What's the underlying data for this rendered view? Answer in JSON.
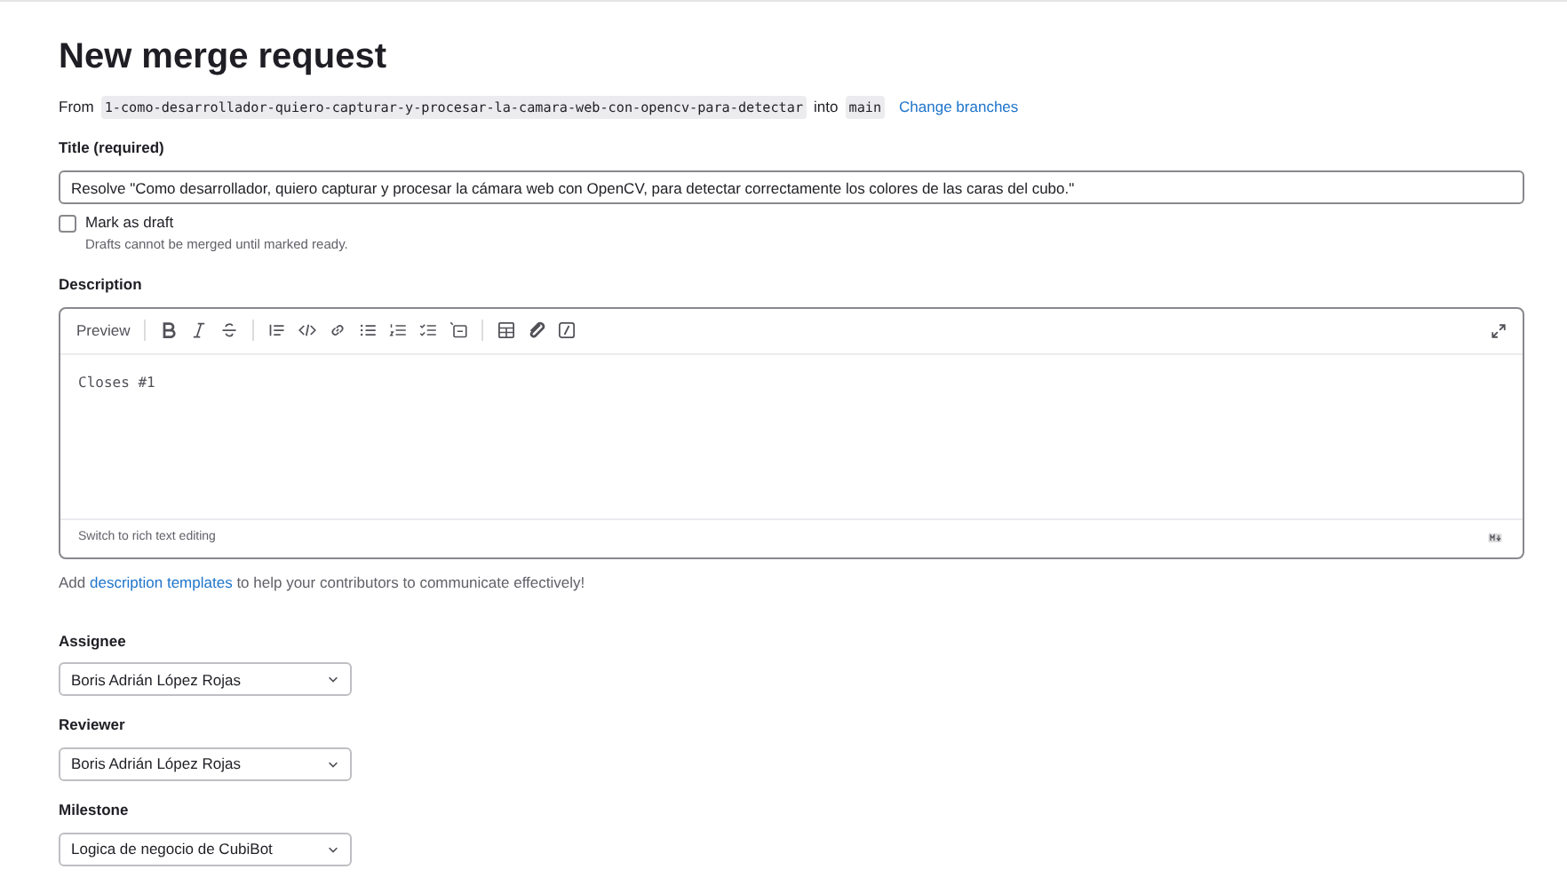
{
  "page_title": "New merge request",
  "branches": {
    "from_label": "From",
    "source": "1-como-desarrollador-quiero-capturar-y-procesar-la-camara-web-con-opencv-para-detectar",
    "into_label": "into",
    "target": "main",
    "change_link": "Change branches"
  },
  "title_field": {
    "label": "Title (required)",
    "value": "Resolve \"Como desarrollador, quiero capturar y procesar la cámara web con OpenCV, para detectar correctamente los colores de las caras del cubo.\""
  },
  "draft": {
    "label": "Mark as draft",
    "checked": false,
    "help": "Drafts cannot be merged until marked ready."
  },
  "description": {
    "label": "Description",
    "preview_tab": "Preview",
    "value": "Closes #1",
    "switch_link": "Switch to rich text editing",
    "help_before": "Add ",
    "help_link": "description templates",
    "help_after": " to help your contributors to communicate effectively!"
  },
  "selects": [
    {
      "label": "Assignee",
      "value": "Boris Adrián López Rojas"
    },
    {
      "label": "Reviewer",
      "value": "Boris Adrián López Rojas"
    },
    {
      "label": "Milestone",
      "value": "Logica de negocio de CubiBot"
    }
  ]
}
